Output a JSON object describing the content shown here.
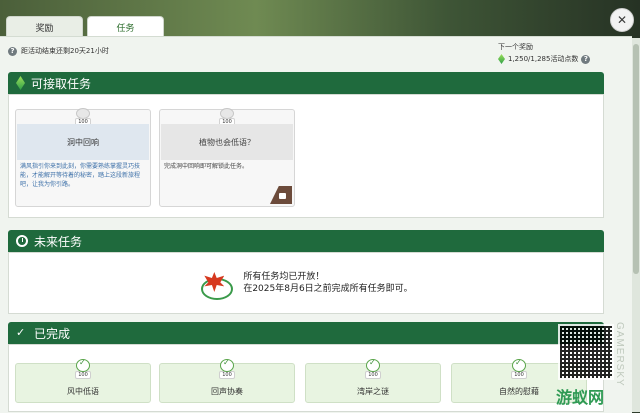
{
  "tabs": [
    "奖励",
    "任务"
  ],
  "active_tab": 1,
  "event_timer": "距活动结束还剩20天21小时",
  "next_reward": {
    "label": "下一个奖励",
    "progress_text": "1,250/1,285活动点数",
    "progress": 0.973
  },
  "sections": {
    "available": {
      "title": "可接取任务",
      "missions": [
        {
          "badge": "100",
          "title": "洞中回响",
          "desc": "满风指引你来到此刻，你需要熟练掌握灵巧技能，才能解开等待着的秘密，踏上这段新旅程吧，让我为你引路。",
          "locked": false
        },
        {
          "badge": "100",
          "title": "植物也会低语？",
          "desc": "完成洞中回响即可解锁此任务。",
          "locked": true
        }
      ]
    },
    "future": {
      "title": "未来任务",
      "line1": "所有任务均已开放！",
      "line2": "在2025年8月6日之前完成所有任务即可。"
    },
    "completed": {
      "title": "已完成",
      "missions": [
        {
          "badge": "100",
          "title": "风中低语"
        },
        {
          "badge": "100",
          "title": "回声协奏"
        },
        {
          "badge": "100",
          "title": "湾岸之谜"
        },
        {
          "badge": "100",
          "title": "自然的慰藉"
        }
      ]
    }
  },
  "watermark": {
    "vertical": "GAMERSKY",
    "text": "游蚁网"
  },
  "colors": {
    "header_green": "#1f6a3d",
    "panel_bg": "#f0f4ef",
    "desc_blue": "#3b6fa8"
  }
}
